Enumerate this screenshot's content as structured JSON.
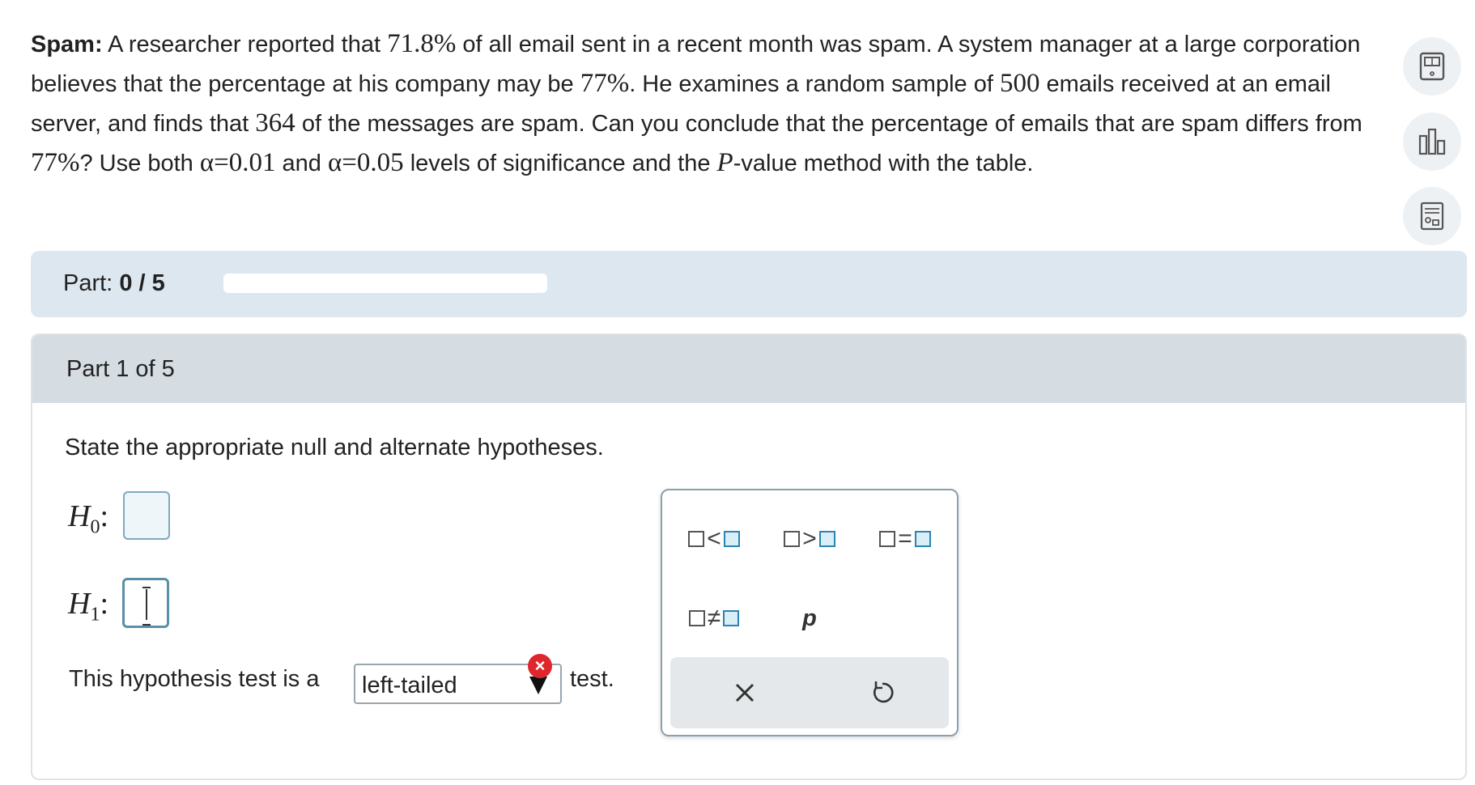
{
  "problem": {
    "title": "Spam:",
    "t1": " A researcher reported that ",
    "m1": "71.8%",
    "t2": " of all email sent in a recent month was spam. A system manager at a large corporation believes that the percentage at his company may be ",
    "m2": "77%",
    "t3": ". He examines a random sample of ",
    "m3": "500",
    "t4": " emails received at an email server, and finds that ",
    "m4": "364",
    "t5": " of the messages are spam. Can you conclude that the percentage of emails that are spam differs from ",
    "m5": "77%",
    "t6": "? Use both ",
    "m6": "α=0.01",
    "t7": " and ",
    "m7": "α=0.05",
    "t8": " levels of significance and the ",
    "m8": "P",
    "t9": "-value method with the table."
  },
  "side_tools": {
    "icons": [
      "calculator-icon",
      "chart-icon",
      "data-sheet-icon"
    ]
  },
  "progress": {
    "label": "Part: ",
    "value": "0 / 5",
    "fraction": 0
  },
  "part": {
    "title": "Part 1 of 5",
    "instruction": "State the appropriate null and alternate hypotheses."
  },
  "hypotheses": {
    "h0_letter": "H",
    "h0_sub": "0",
    "h1_letter": "H",
    "h1_sub": "1",
    "colon": ":"
  },
  "test": {
    "prefix": "This hypothesis test is a",
    "selected": "left-tailed",
    "suffix": "test."
  },
  "palette": {
    "less_than": "<",
    "greater_than": ">",
    "equals": "=",
    "not_equals": "≠",
    "p_symbol": "p",
    "clear_label": "×"
  },
  "colors": {
    "accent": "#2b84b3",
    "error": "#e0262d",
    "part_bar": "#dde7ef",
    "part_header": "#d5dce2"
  }
}
